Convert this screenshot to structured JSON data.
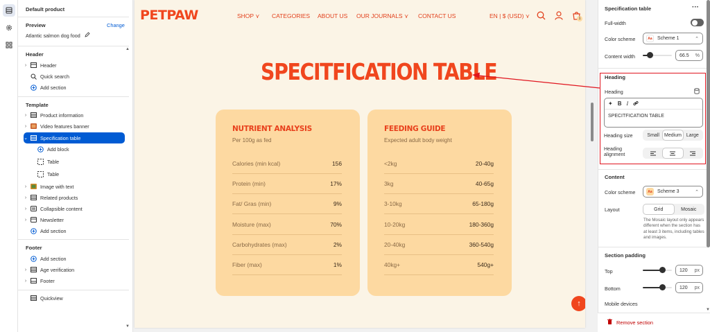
{
  "left_panel": {
    "template_name": "Default product",
    "preview_label": "Preview",
    "change_label": "Change",
    "preview_value": "Atlantic salmon dog food",
    "header_title": "Header",
    "header_items": [
      {
        "label": "Header",
        "icon": "layout-header-icon"
      },
      {
        "label": "Quick search",
        "icon": "search-icon"
      }
    ],
    "add_section": "Add section",
    "template_title": "Template",
    "template_items": [
      {
        "label": "Product information",
        "icon": "table-icon"
      },
      {
        "label": "Video features banner",
        "icon": "image-icon"
      },
      {
        "label": "Specification table",
        "icon": "table-icon"
      }
    ],
    "add_block": "Add block",
    "block_items": [
      "Table",
      "Table"
    ],
    "more_items": [
      {
        "label": "Image with text",
        "icon": "image-icon"
      },
      {
        "label": "Related products",
        "icon": "table-icon"
      },
      {
        "label": "Collapsible content",
        "icon": "list-icon"
      },
      {
        "label": "Newsletter",
        "icon": "mail-icon"
      }
    ],
    "footer_title": "Footer",
    "footer_items": [
      {
        "label": "Age verification",
        "icon": "table-icon"
      },
      {
        "label": "Footer",
        "icon": "layout-footer-icon"
      }
    ],
    "quickview": "Quickview"
  },
  "store": {
    "logo": "PETPAW",
    "nav": [
      "SHOP ⋎",
      "CATEGORIES",
      "ABOUT US",
      "OUR JOURNALS ⋎",
      "CONTACT US"
    ],
    "locale": "EN | $ (USD) ⋎",
    "cart_count": "1",
    "title": "SPECITFICATION TABLE",
    "cards": [
      {
        "title": "NUTRIENT ANALYSIS",
        "subtitle": "Per 100g as fed",
        "rows": [
          [
            "Calories (min kcal)",
            "156"
          ],
          [
            "Protein (min)",
            "17%"
          ],
          [
            "Fat/ Gras (min)",
            "9%"
          ],
          [
            "Moisture (max)",
            "70%"
          ],
          [
            "Carbohydrates (max)",
            "2%"
          ],
          [
            "Fiber (max)",
            "1%"
          ]
        ]
      },
      {
        "title": "FEEDING GUIDE",
        "subtitle": "Expected adult body weight",
        "rows": [
          [
            "<2kg",
            "20-40g"
          ],
          [
            "3kg",
            "40-65g"
          ],
          [
            "3-10kg",
            "65-180g"
          ],
          [
            "10-20kg",
            "180-360g"
          ],
          [
            "20-40kg",
            "360-540g"
          ],
          [
            "40kg+",
            "540g+"
          ]
        ]
      }
    ],
    "colors": {
      "accent": "#f0461e",
      "card": "#fdd9a1",
      "page": "#fbf4e6"
    }
  },
  "settings": {
    "title": "Specification table",
    "more": "···",
    "full_width": "Full-width",
    "color_scheme": "Color scheme",
    "scheme_1": "Scheme 1",
    "content_width": "Content width",
    "content_width_value": "66.5",
    "percent": "%",
    "heading_section": "Heading",
    "heading_label": "Heading",
    "heading_value": "SPECITFICATION TABLE",
    "heading_size": "Heading size",
    "sizes": [
      "Small",
      "Medium",
      "Large"
    ],
    "heading_alignment": "Heading alignment",
    "content_section": "Content",
    "content_color_scheme": "Color scheme",
    "scheme_3": "Scheme 3",
    "layout": "Layout",
    "layouts": [
      "Grid",
      "Mosaic"
    ],
    "layout_help": "The Mosaic layout only appears different when the section has at least 3 items, including tables and images.",
    "padding_section": "Section padding",
    "top": "Top",
    "top_value": "120",
    "bottom": "Bottom",
    "bottom_value": "120",
    "px": "px",
    "mobile": "Mobile devices",
    "remove": "Remove section"
  }
}
